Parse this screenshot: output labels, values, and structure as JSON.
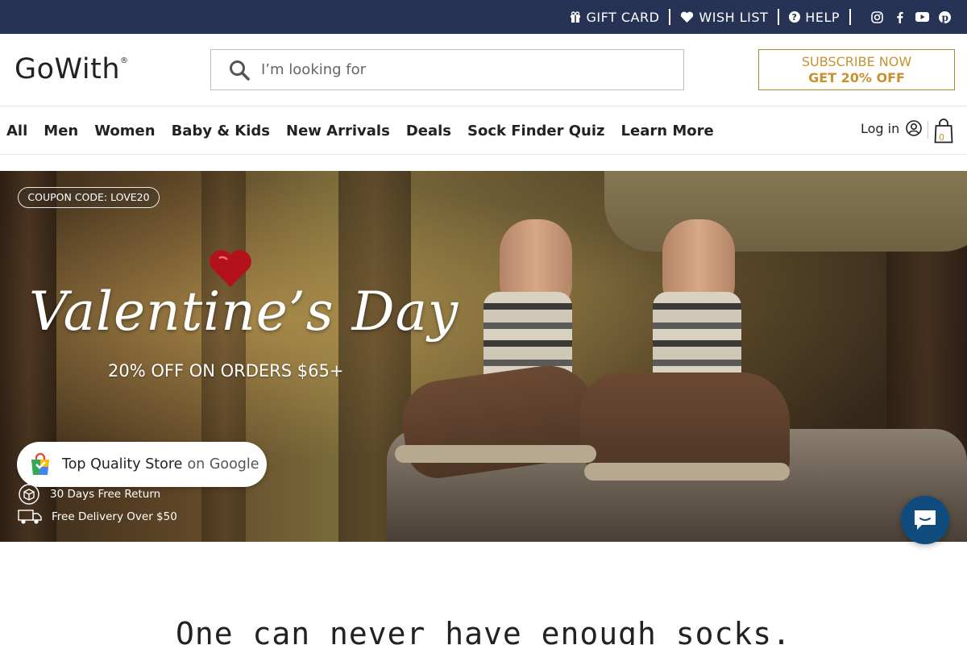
{
  "topbar": {
    "gift_card": "GIFT CARD",
    "wish_list": "WISH LIST",
    "help": "HELP",
    "icons": [
      "gift-icon",
      "heart-icon",
      "question-icon",
      "instagram-icon",
      "facebook-icon",
      "youtube-icon",
      "pinterest-icon"
    ]
  },
  "header": {
    "logo": "GoWith",
    "logo_mark": "®",
    "search_placeholder": "I’m looking for",
    "subscribe_line1": "SUBSCRIBE NOW",
    "subscribe_line2": "GET 20% OFF"
  },
  "nav": {
    "items": [
      "All",
      "Men",
      "Women",
      "Baby & Kids",
      "New Arrivals",
      "Deals",
      "Sock Finder Quiz",
      "Learn More"
    ],
    "login": "Log in",
    "cart_count": "0"
  },
  "hero": {
    "coupon": "COUPON CODE: LOVE20",
    "title": "Valentine’s Day",
    "offer": "20% OFF ON ORDERS $65+",
    "badge_main": "Top Quality Store",
    "badge_suffix": "on Google",
    "perk1": "30 Days Free Return",
    "perk2": "Free Delivery Over $50"
  },
  "tagline": "One can never have enough socks.",
  "colors": {
    "topbar": "#263354",
    "accent_gold": "#c6922f",
    "chat": "#0f4b7d"
  }
}
